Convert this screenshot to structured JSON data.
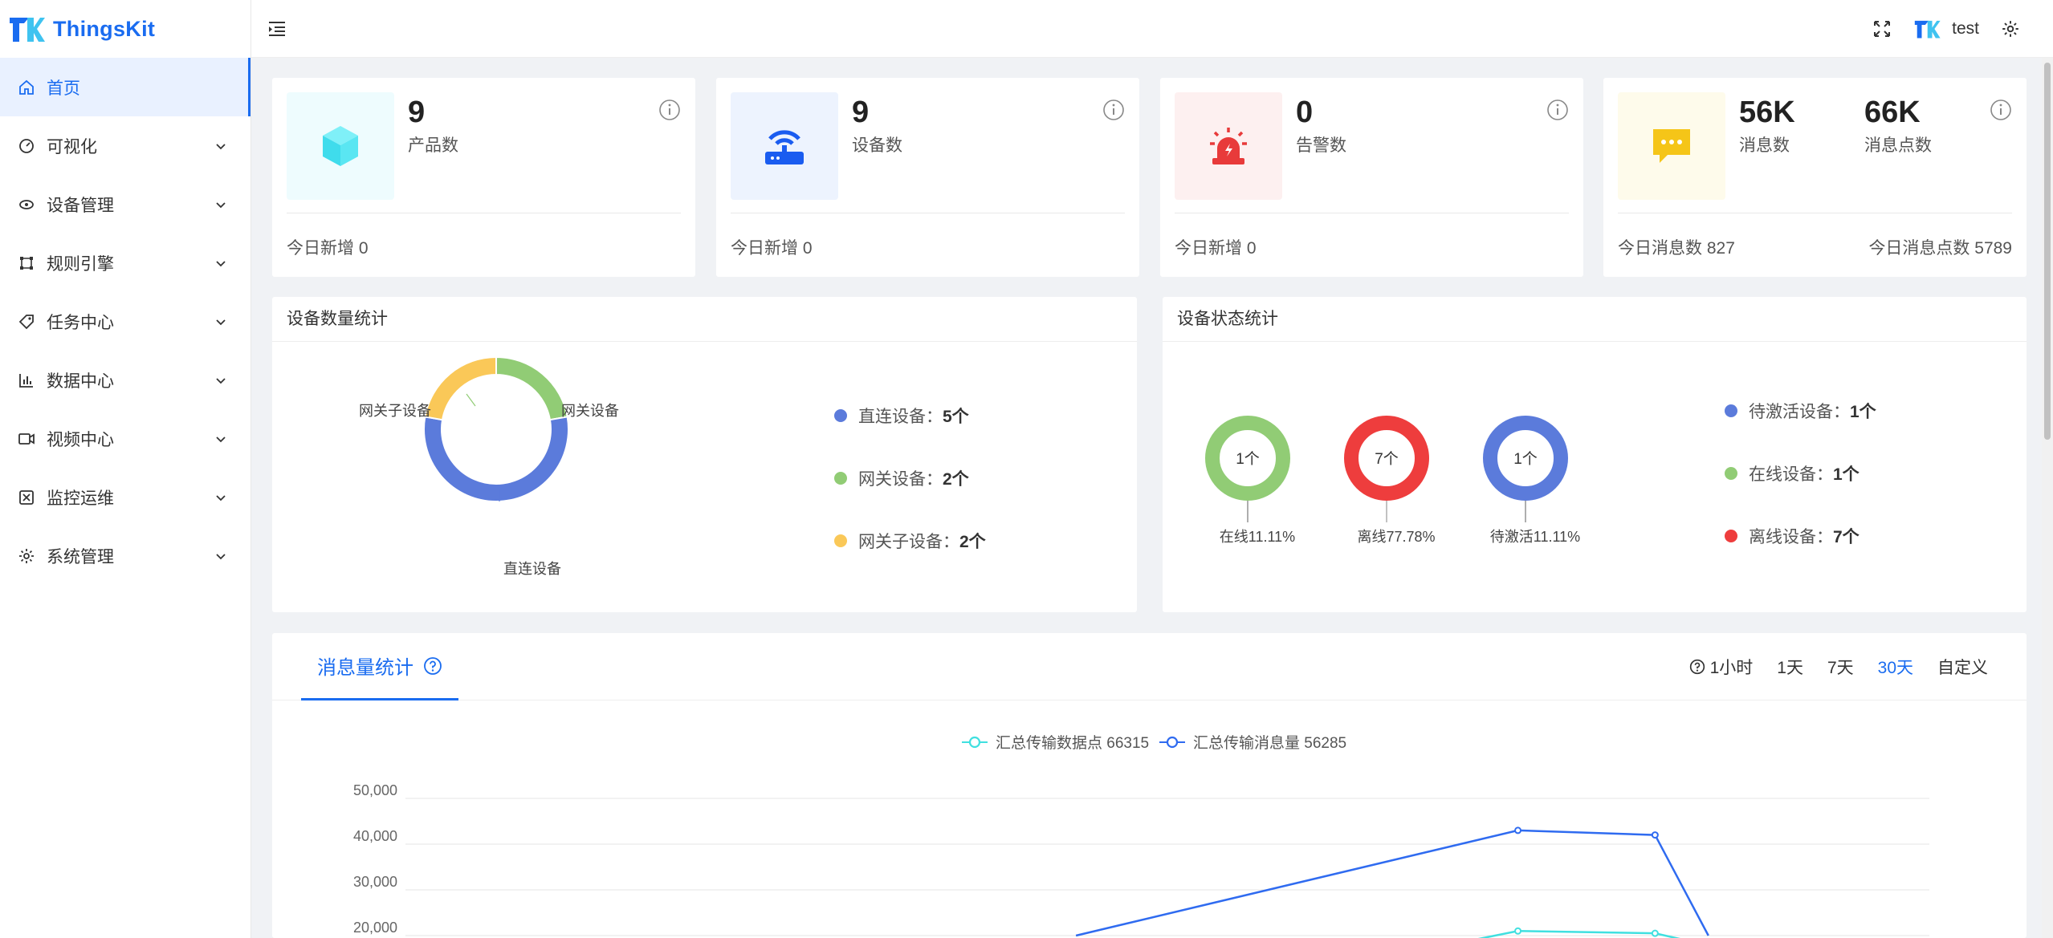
{
  "app": {
    "brand": "ThingsKit"
  },
  "sidebar": {
    "items": [
      {
        "label": "首页",
        "icon": "home-icon",
        "active": true
      },
      {
        "label": "可视化",
        "icon": "dashboard-icon"
      },
      {
        "label": "设备管理",
        "icon": "device-icon"
      },
      {
        "label": "规则引擎",
        "icon": "rule-icon"
      },
      {
        "label": "任务中心",
        "icon": "tag-icon"
      },
      {
        "label": "数据中心",
        "icon": "bar-chart-icon"
      },
      {
        "label": "视频中心",
        "icon": "video-icon"
      },
      {
        "label": "监控运维",
        "icon": "monitor-icon"
      },
      {
        "label": "系统管理",
        "icon": "gear-icon"
      }
    ]
  },
  "header": {
    "username": "test"
  },
  "stats": {
    "product": {
      "value": "9",
      "label": "产品数",
      "foot": "今日新增 0"
    },
    "device": {
      "value": "9",
      "label": "设备数",
      "foot": "今日新增 0"
    },
    "alarm": {
      "value": "0",
      "label": "告警数",
      "foot": "今日新增 0"
    },
    "message": {
      "value": "56K",
      "label": "消息数",
      "points_value": "66K",
      "points_label": "消息点数",
      "foot_left": "今日消息数 827",
      "foot_right": "今日消息点数 5789"
    }
  },
  "device_count_panel": {
    "title": "设备数量统计",
    "labels": {
      "direct": "直连设备",
      "gateway": "网关设备",
      "sub": "网关子设备"
    },
    "legend": [
      {
        "name": "直连设备：",
        "count": "5个",
        "color": "#5b7bdb"
      },
      {
        "name": "网关设备：",
        "count": "2个",
        "color": "#91cc75"
      },
      {
        "name": "网关子设备：",
        "count": "2个",
        "color": "#fac858"
      }
    ]
  },
  "device_status_panel": {
    "title": "设备状态统计",
    "rings": [
      {
        "center": "1个",
        "label": "在线11.11%",
        "color": "#91cc75"
      },
      {
        "center": "7个",
        "label": "离线77.78%",
        "color": "#ee3d3d"
      },
      {
        "center": "1个",
        "label": "待激活11.11%",
        "color": "#5b7bdb"
      }
    ],
    "legend": [
      {
        "name": "待激活设备：",
        "count": "1个",
        "color": "#5b7bdb"
      },
      {
        "name": "在线设备：",
        "count": "1个",
        "color": "#91cc75"
      },
      {
        "name": "离线设备：",
        "count": "7个",
        "color": "#ee3d3d"
      }
    ]
  },
  "message_panel": {
    "tab": "消息量统计",
    "ranges": [
      "1小时",
      "1天",
      "7天",
      "30天",
      "自定义"
    ],
    "selected_range": "30天",
    "legend": [
      {
        "name": "汇总传输数据点 66315",
        "color": "#40e0e0"
      },
      {
        "name": "汇总传输消息量 56285",
        "color": "#2f6bf0"
      }
    ]
  },
  "chart_data": [
    {
      "type": "pie",
      "title": "设备数量统计",
      "categories": [
        "直连设备",
        "网关设备",
        "网关子设备"
      ],
      "values": [
        5,
        2,
        2
      ],
      "colors": [
        "#5b7bdb",
        "#91cc75",
        "#fac858"
      ]
    },
    {
      "type": "pie",
      "title": "设备状态统计",
      "categories": [
        "在线",
        "离线",
        "待激活"
      ],
      "values": [
        1,
        7,
        1
      ],
      "colors": [
        "#91cc75",
        "#ee3d3d",
        "#5b7bdb"
      ]
    },
    {
      "type": "line",
      "title": "消息量统计",
      "y_ticks": [
        "50,000",
        "40,000",
        "30,000",
        "20,000"
      ],
      "ylim": [
        0,
        50000
      ],
      "series": [
        {
          "name": "汇总传输数据点 66315",
          "color": "#40e0e0",
          "x": [
            0.73,
            0.82
          ],
          "y": [
            21000,
            20500
          ]
        },
        {
          "name": "汇总传输消息量 56285",
          "color": "#2f6bf0",
          "x": [
            0.44,
            0.73,
            0.82,
            0.855
          ],
          "y": [
            20000,
            43000,
            42000,
            20000
          ]
        }
      ]
    }
  ]
}
